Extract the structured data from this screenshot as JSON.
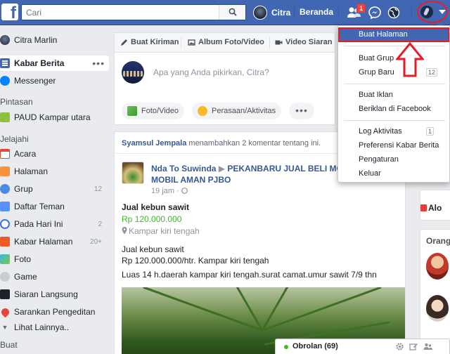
{
  "topbar": {
    "logo": "f",
    "search_placeholder": "Cari",
    "profile_name": "Citra",
    "home_label": "Beranda",
    "friend_requests_badge": "1"
  },
  "sidebar": {
    "user": "Citra Marlin",
    "top_items": [
      {
        "label": "Kabar Berita",
        "more": "•••"
      },
      {
        "label": "Messenger"
      }
    ],
    "shortcuts_heading": "Pintasan",
    "shortcuts": [
      {
        "label": "PAUD Kampar utara"
      }
    ],
    "explore_heading": "Jelajahi",
    "explore": [
      {
        "label": "Acara",
        "count": ""
      },
      {
        "label": "Halaman",
        "count": ""
      },
      {
        "label": "Grup",
        "count": "12"
      },
      {
        "label": "Daftar Teman",
        "count": ""
      },
      {
        "label": "Pada Hari Ini",
        "count": "2"
      },
      {
        "label": "Kabar Halaman",
        "count": "20+"
      },
      {
        "label": "Foto",
        "count": ""
      },
      {
        "label": "Game",
        "count": ""
      },
      {
        "label": "Siaran Langsung",
        "count": ""
      },
      {
        "label": "Sarankan Pengeditan",
        "count": ""
      }
    ],
    "see_more": "Lihat Lainnya..",
    "create_heading": "Buat"
  },
  "composer": {
    "tabs": [
      "Buat Kiriman",
      "Album Foto/Video",
      "Video Siaran L"
    ],
    "prompt": "Apa yang Anda pikirkan, Citra?",
    "actions": [
      "Foto/Video",
      "Perasaan/Aktivitas"
    ],
    "more": "•••"
  },
  "post": {
    "header_actor": "Syamsul Jempala",
    "header_text": "menambahkan 2 komentar tentang ini.",
    "header_more": "•••",
    "author": "Nda To Suwinda",
    "arrow": "▶",
    "group": "PEKANBARU JUAL BELI MO",
    "group_line2": "MOBIL AMAN PJBO",
    "time": "19 jam",
    "listing_title": "Jual kebun sawit",
    "price": "Rp 120.000.000",
    "location": "Kampar kiri tengah",
    "body": [
      "Jual kebun sawit",
      "Rp 120.000.000/htr. Kampar kiri tengah",
      "Luas 14 h.daerah kampar kiri tengah.surat camat.umur sawit 7/9 thn"
    ]
  },
  "right": {
    "card_text": "Alo",
    "people_heading": "Orang"
  },
  "menu": {
    "items": [
      {
        "label": "Buat Halaman",
        "highlight": true
      },
      {
        "label": "Buat Grup"
      },
      {
        "label": "Grup Baru",
        "count": "12"
      },
      {
        "label": "Buat Iklan"
      },
      {
        "label": "Beriklan di Facebook"
      },
      {
        "label": "Log Aktivitas",
        "count": "1"
      },
      {
        "label": "Preferensi Kabar Berita"
      },
      {
        "label": "Pengaturan"
      },
      {
        "label": "Keluar"
      }
    ]
  },
  "chat": {
    "label": "Obrolan (69)"
  },
  "colors": {
    "brand": "#4267b2",
    "annotation_red": "#e41e26",
    "online_green": "#42b72a",
    "link": "#365899"
  }
}
